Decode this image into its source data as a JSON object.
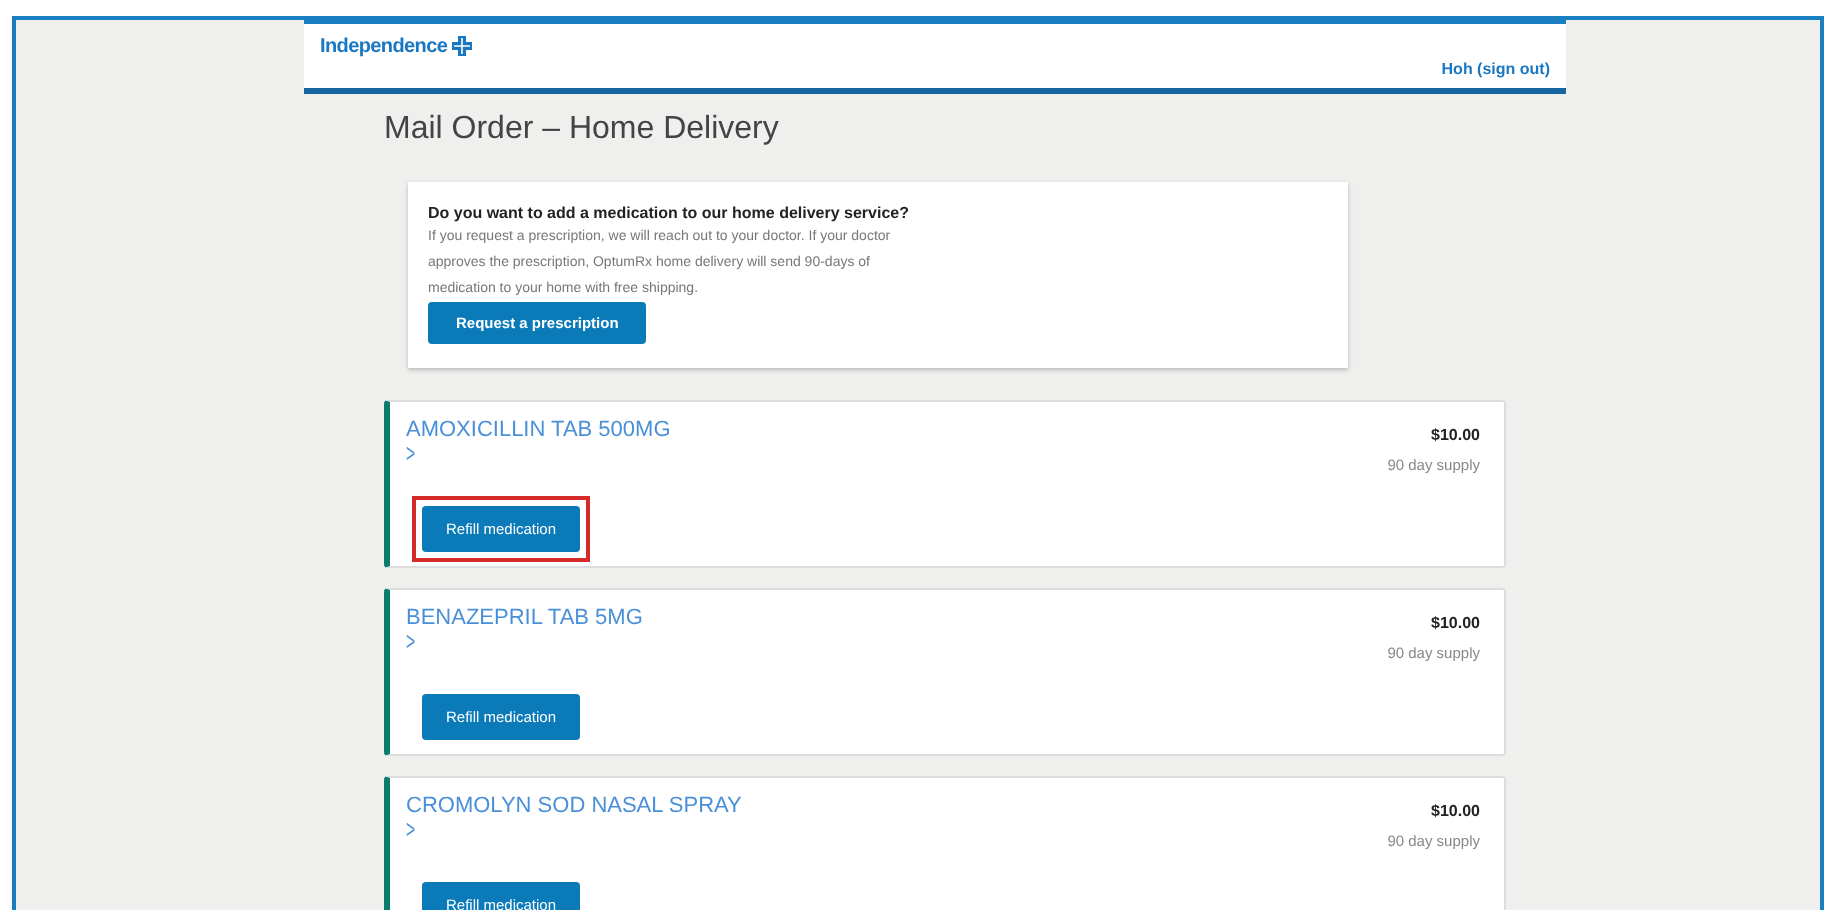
{
  "header": {
    "brand": "Independence",
    "user_link": "Hoh (sign out)"
  },
  "page_title": "Mail Order – Home Delivery",
  "promo": {
    "heading": "Do you want to add a medication to our home delivery service?",
    "body": "If you request a prescription, we will reach out to your doctor. If your doctor approves the prescription, OptumRx home delivery will send 90-days of medication to your home with free shipping.",
    "button": "Request a prescription"
  },
  "medications": [
    {
      "name": "AMOXICILLIN TAB 500MG",
      "chevron": ">",
      "price": "$10.00",
      "supply": "90 day supply",
      "button": "Refill medication",
      "highlighted": true
    },
    {
      "name": "BENAZEPRIL TAB 5MG",
      "chevron": ">",
      "price": "$10.00",
      "supply": "90 day supply",
      "button": "Refill medication",
      "highlighted": false
    },
    {
      "name": "CROMOLYN SOD NASAL SPRAY",
      "chevron": ">",
      "price": "$10.00",
      "supply": "90 day supply",
      "button": "Refill medication",
      "highlighted": false
    }
  ]
}
